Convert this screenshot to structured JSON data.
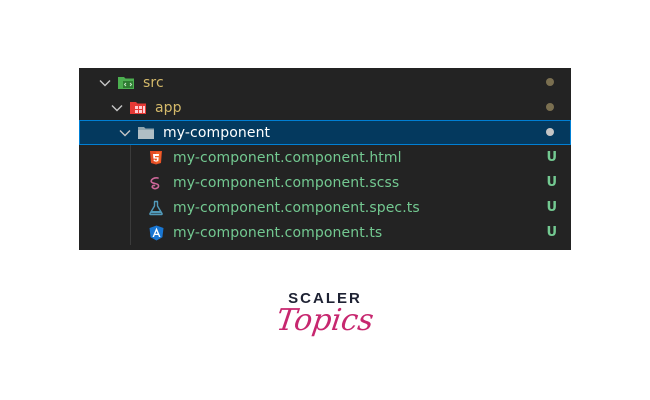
{
  "tree": [
    {
      "label": "src",
      "type": "folder",
      "icon": "src-folder-icon",
      "status": "dot"
    },
    {
      "label": "app",
      "type": "folder",
      "icon": "app-folder-icon",
      "status": "dot"
    },
    {
      "label": "my-component",
      "type": "folder",
      "icon": "folder-icon",
      "status": "dot",
      "selected": true
    },
    {
      "label": "my-component.component.html",
      "type": "file",
      "icon": "html5-icon",
      "status": "U"
    },
    {
      "label": "my-component.component.scss",
      "type": "file",
      "icon": "sass-icon",
      "status": "U"
    },
    {
      "label": "my-component.component.spec.ts",
      "type": "file",
      "icon": "test-flask-icon",
      "status": "U"
    },
    {
      "label": "my-component.component.ts",
      "type": "file",
      "icon": "angular-icon",
      "status": "U"
    }
  ],
  "logo": {
    "top": "SCALER",
    "script": "Topics"
  },
  "colors": {
    "background": "#232323",
    "selected": "#04395e",
    "untracked": "#73c991",
    "html": "#e44d26",
    "sass": "#cd6799",
    "test": "#519aba",
    "angular": "#1976d2",
    "src_folder": "#4caf50",
    "app_folder": "#e53935",
    "brand": "#c7276f"
  }
}
